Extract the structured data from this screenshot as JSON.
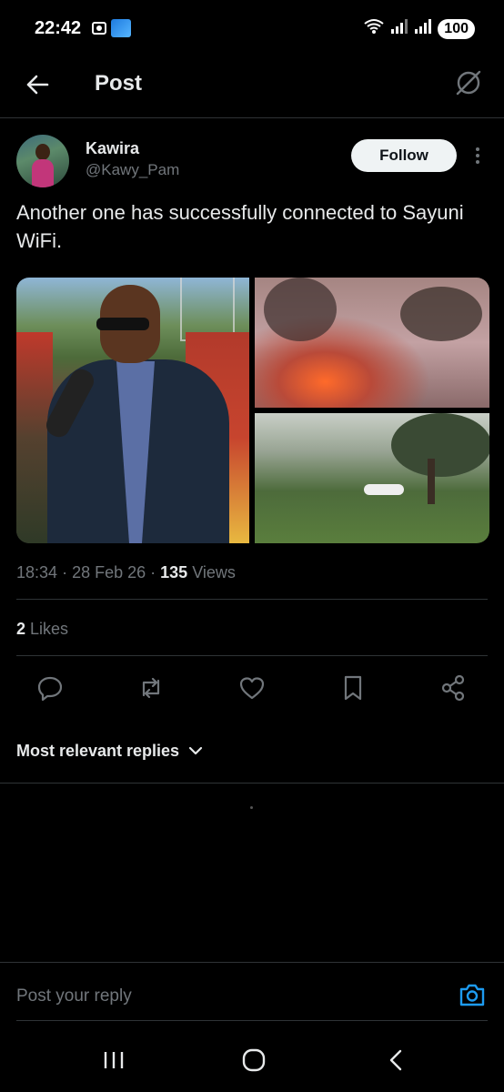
{
  "status_bar": {
    "time": "22:42",
    "battery": "100"
  },
  "header": {
    "title": "Post"
  },
  "post": {
    "author_name": "Kawira",
    "author_handle": "@Kawy_Pam",
    "follow_label": "Follow",
    "text": "Another one has successfully connected to Sayuni WiFi.",
    "meta": {
      "time": "18:34",
      "date": "28 Feb 26",
      "views_count": "135",
      "views_label": "Views"
    },
    "likes": {
      "count": "2",
      "label": "Likes"
    }
  },
  "actions": [
    "reply-icon",
    "repost-icon",
    "like-icon",
    "bookmark-icon",
    "share-icon"
  ],
  "replies": {
    "sort_label": "Most relevant replies"
  },
  "reply_input": {
    "placeholder": "Post your reply"
  },
  "colors": {
    "background": "#000000",
    "text": "#e7e9ea",
    "muted": "#71767b",
    "accent": "#1d9bf0",
    "divider": "#2f3336"
  }
}
